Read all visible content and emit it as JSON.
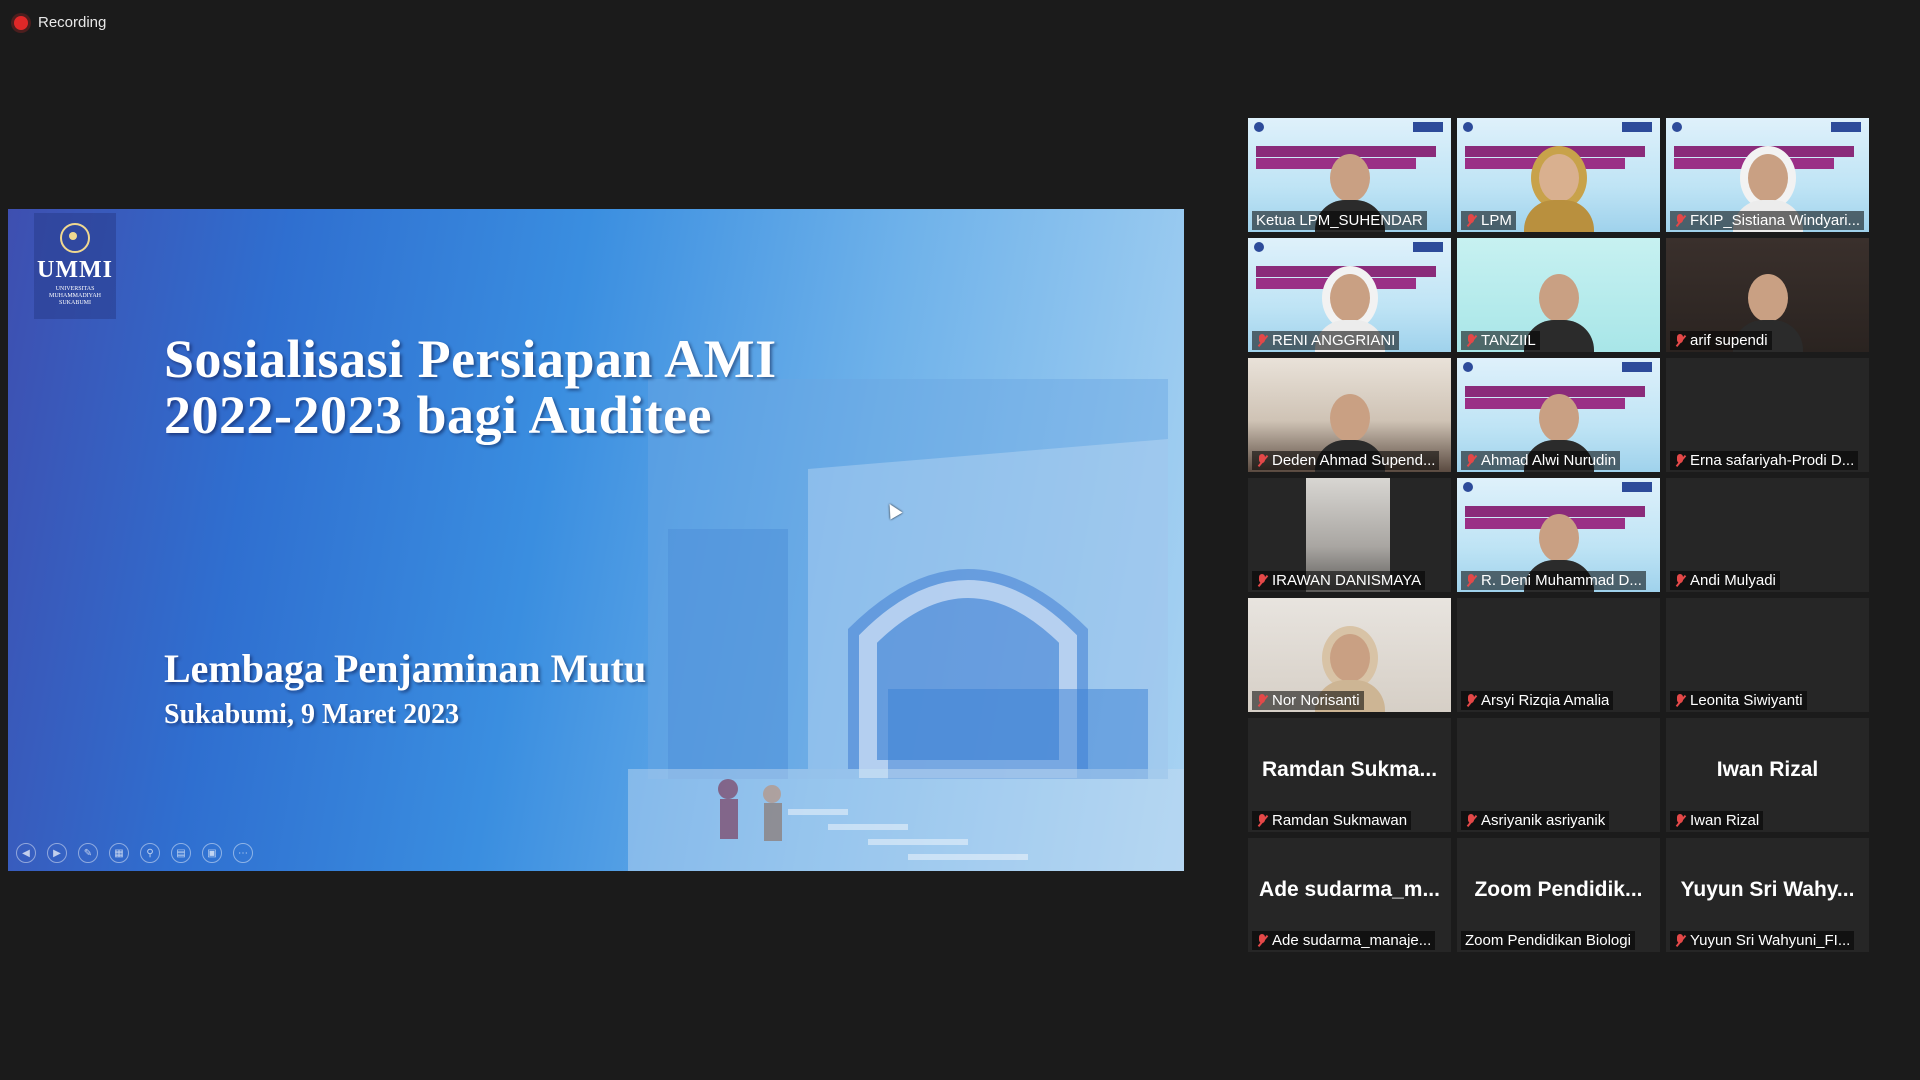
{
  "recording": {
    "label": "Recording"
  },
  "slide": {
    "logo_text": "UMMI",
    "logo_sub": "UNIVERSITAS MUHAMMADIYAH SUKABUMI",
    "title_line1": "Sosialisasi Persiapan AMI",
    "title_line2": "2022-2023 bagi Auditee",
    "organization": "Lembaga Penjaminan Mutu",
    "place_date": "Sukabumi, 9 Maret 2023",
    "toolbar_icons": [
      "prev-icon",
      "next-icon",
      "pen-icon",
      "slides-icon",
      "zoom-icon",
      "subtitles-icon",
      "video-icon",
      "more-icon"
    ]
  },
  "participants": [
    {
      "name": "Ketua LPM_SUHENDAR",
      "muted": false,
      "video": "slide",
      "avatar": "",
      "active": true
    },
    {
      "name": "LPM",
      "muted": true,
      "video": "slide-hijab",
      "avatar": ""
    },
    {
      "name": "FKIP_Sistiana Windyari...",
      "muted": true,
      "video": "slide-white",
      "avatar": ""
    },
    {
      "name": "RENI ANGGRIANI",
      "muted": true,
      "video": "slide-white",
      "avatar": ""
    },
    {
      "name": "TANZIIL",
      "muted": true,
      "video": "cyan",
      "avatar": ""
    },
    {
      "name": "arif supendi",
      "muted": true,
      "video": "dark",
      "avatar": ""
    },
    {
      "name": "Deden Ahmad Supend...",
      "muted": true,
      "video": "room",
      "avatar": ""
    },
    {
      "name": "Ahmad Alwi Nurudin",
      "muted": true,
      "video": "slide",
      "avatar": ""
    },
    {
      "name": "Erna safariyah-Prodi D...",
      "muted": true,
      "video": "none",
      "avatar": ""
    },
    {
      "name": "IRAWAN DANISMAYA",
      "muted": true,
      "video": "narrow",
      "avatar": ""
    },
    {
      "name": "R. Deni Muhammad D...",
      "muted": true,
      "video": "slide",
      "avatar": ""
    },
    {
      "name": "Andi Mulyadi",
      "muted": true,
      "video": "none",
      "avatar": ""
    },
    {
      "name": "Nor Norisanti",
      "muted": true,
      "video": "wall",
      "avatar": ""
    },
    {
      "name": "Arsyi Rizqia Amalia",
      "muted": true,
      "video": "none",
      "avatar": ""
    },
    {
      "name": "Leonita Siwiyanti",
      "muted": true,
      "video": "none",
      "avatar": ""
    },
    {
      "name": "Ramdan Sukmawan",
      "muted": true,
      "video": "none",
      "avatar": "Ramdan Sukma..."
    },
    {
      "name": "Asriyanik asriyanik",
      "muted": true,
      "video": "none",
      "avatar": ""
    },
    {
      "name": "Iwan Rizal",
      "muted": true,
      "video": "none",
      "avatar": "Iwan Rizal"
    },
    {
      "name": "Ade sudarma_manaje...",
      "muted": true,
      "video": "none",
      "avatar": "Ade sudarma_m..."
    },
    {
      "name": "Zoom Pendidikan Biologi",
      "muted": false,
      "video": "none",
      "avatar": "Zoom Pendidik..."
    },
    {
      "name": "Yuyun Sri Wahyuni_FI...",
      "muted": true,
      "video": "none",
      "avatar": "Yuyun Sri Wahy..."
    }
  ],
  "colors": {
    "background": "#1b1b1b",
    "active_speaker": "#b6e85a",
    "muted_icon": "#e34848",
    "recording": "#e02828"
  }
}
